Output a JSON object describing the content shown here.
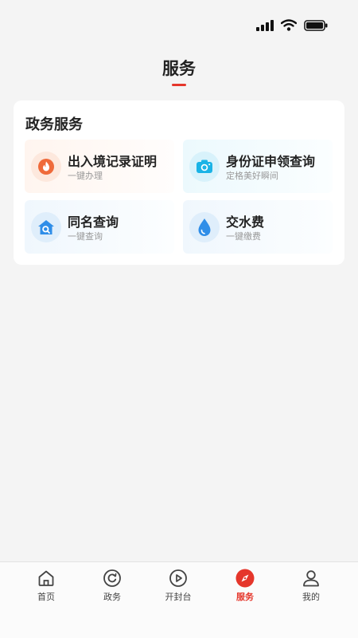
{
  "header": {
    "title": "服务"
  },
  "section": {
    "title": "政务服务"
  },
  "services": [
    {
      "name": "出入境记录证明",
      "desc": "一键办理",
      "icon": "fire-icon",
      "color": "#ef6a3a"
    },
    {
      "name": "身份证申领查询",
      "desc": "定格美好瞬间",
      "icon": "camera-icon",
      "color": "#1ab3e6"
    },
    {
      "name": "同名查询",
      "desc": "一键查询",
      "icon": "house-search-icon",
      "color": "#2f8ee8"
    },
    {
      "name": "交水费",
      "desc": "一键缴费",
      "icon": "water-drop-icon",
      "color": "#2f8ee8"
    }
  ],
  "nav": [
    {
      "label": "首页",
      "icon": "home-icon",
      "active": false
    },
    {
      "label": "政务",
      "icon": "refresh-circle-icon",
      "active": false
    },
    {
      "label": "开封台",
      "icon": "play-circle-icon",
      "active": false
    },
    {
      "label": "服务",
      "icon": "compass-icon",
      "active": true
    },
    {
      "label": "我的",
      "icon": "user-icon",
      "active": false
    }
  ],
  "colors": {
    "accent": "#e5362b",
    "background": "#f4f4f4"
  }
}
